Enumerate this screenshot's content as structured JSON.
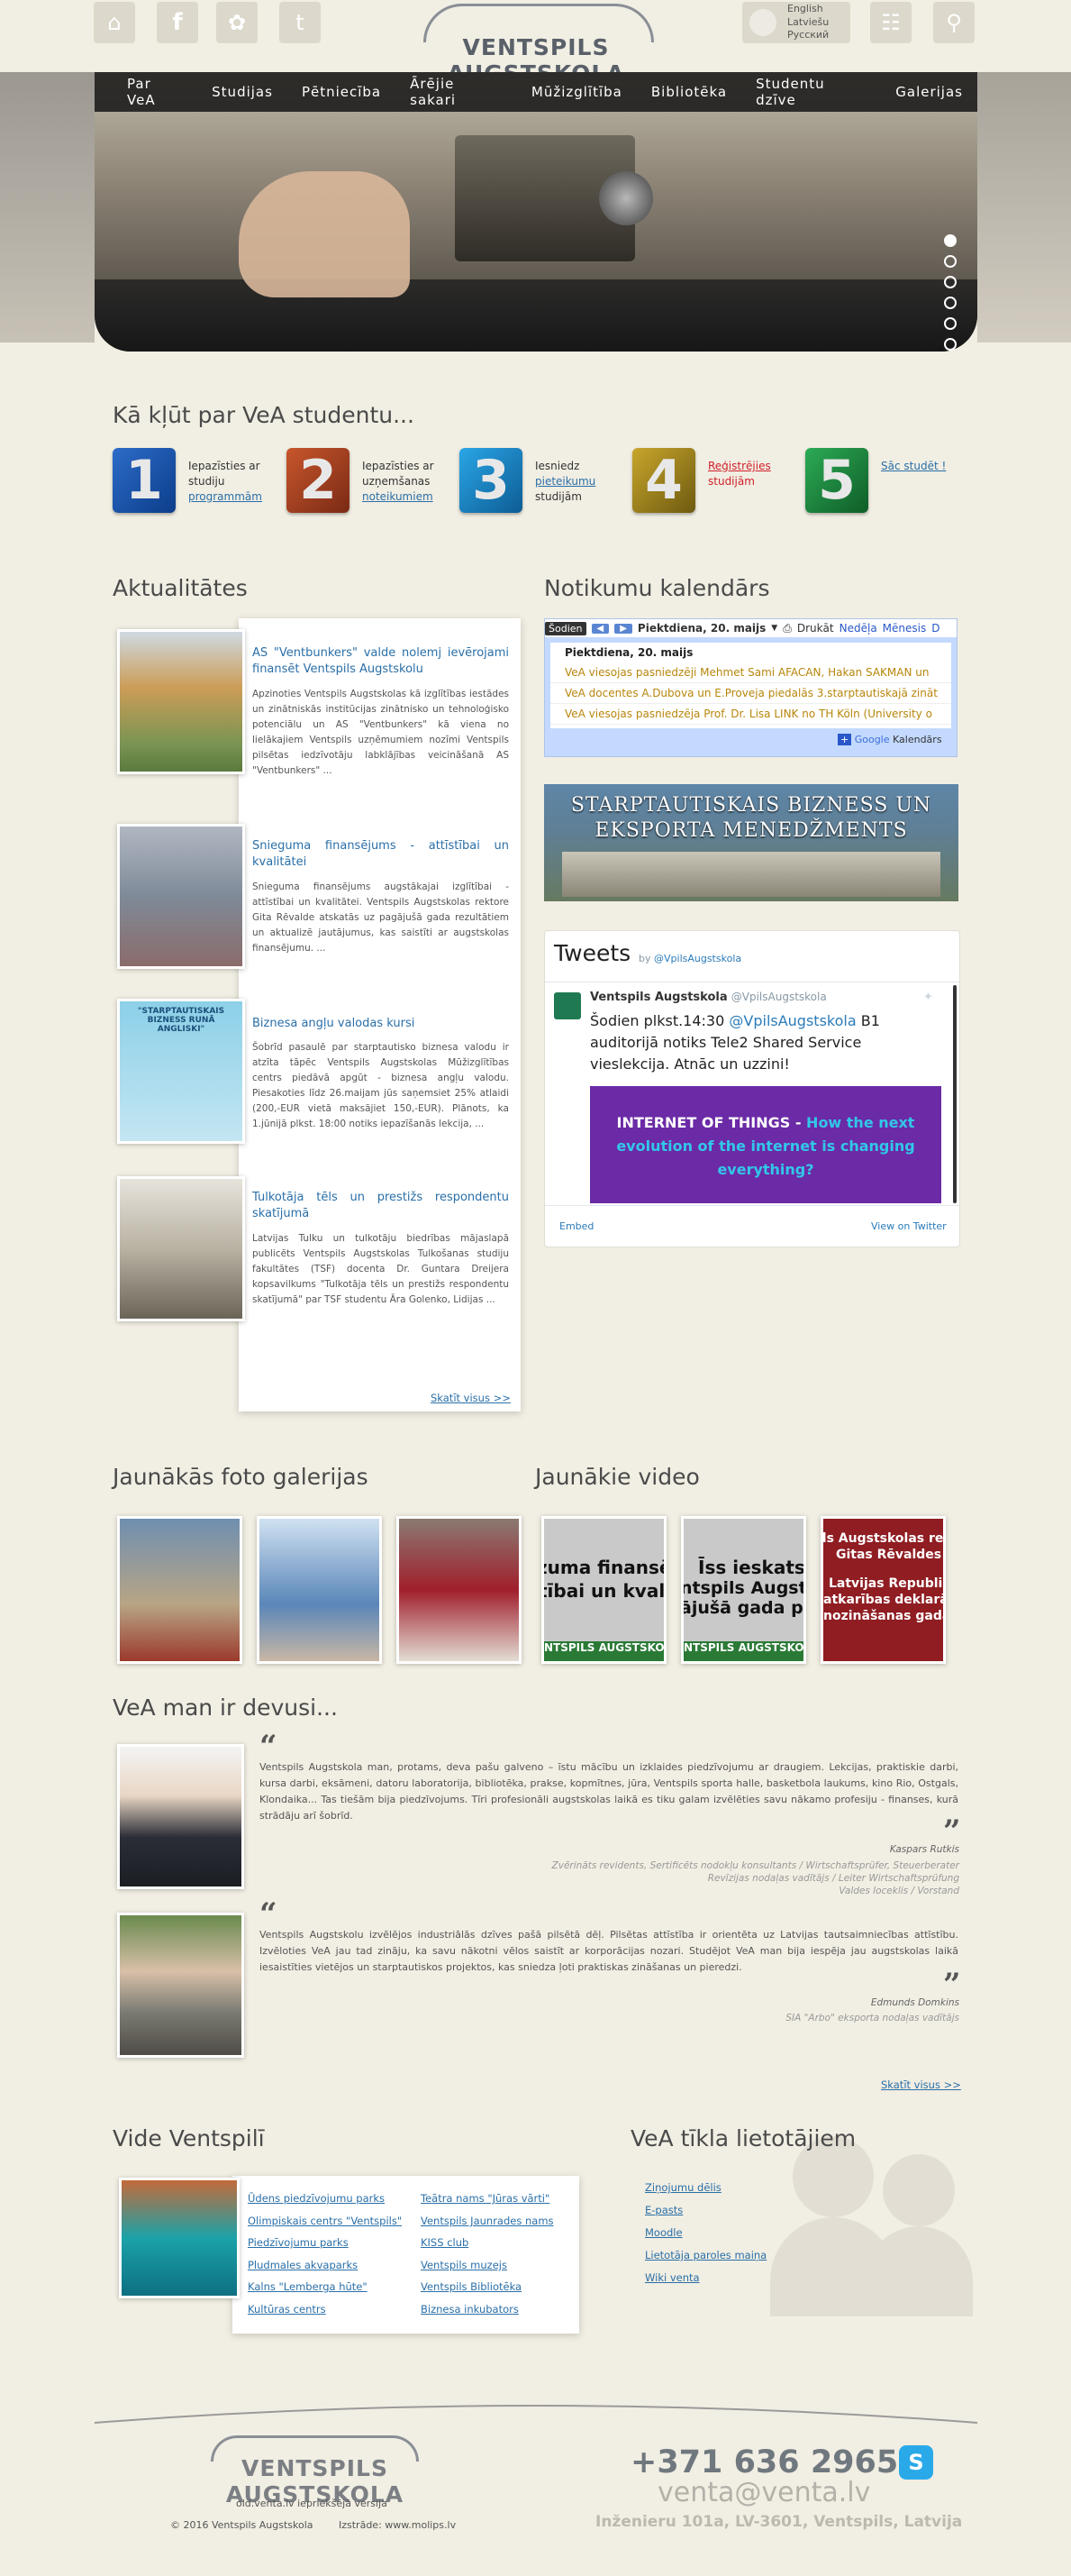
{
  "header": {
    "logo_text": "VENTSPILS AUGSTSKOLA",
    "languages": [
      "English",
      "Latviešu",
      "Русский"
    ]
  },
  "nav": [
    "Par VeA",
    "Studijas",
    "Pētniecība",
    "Ārējie sakari",
    "Mūžizglītība",
    "Bibliotēka",
    "Studentu dzīve",
    "Galerijas"
  ],
  "become_student": {
    "title": "Kā kļūt par VeA studentu...",
    "steps": [
      {
        "num": "1",
        "pre": "Iepazīsties ar studiju",
        "link": "programmām",
        "post": ""
      },
      {
        "num": "2",
        "pre": "Iepazīsties ar uzņemšanas",
        "link": "noteikumiem",
        "post": ""
      },
      {
        "num": "3",
        "pre": "Iesniedz",
        "link": "pieteikumu",
        "post": "studijām"
      },
      {
        "num": "4",
        "pre": "",
        "link": "Reģistrējies",
        "post": "studijām"
      },
      {
        "num": "5",
        "pre": "",
        "link": "Sāc studēt !",
        "post": ""
      }
    ]
  },
  "news": {
    "title": "Aktualitātes",
    "items": [
      {
        "title": "AS \"Ventbunkers\" valde nolemj ievērojami finansēt Ventspils Augstskolu",
        "text": "Apzinoties Ventspils Augstskolas kā izglītības iestādes un zinātniskās institūcijas zinātnisko un tehnoloģisko potenciālu un AS \"Ventbunkers\" kā viena no lielākajiem Ventspils uzņēmumiem nozīmi Ventspils pilsētas iedzīvotāju labklājības veicināšanā AS \"Ventbunkers\" ..."
      },
      {
        "title": "Snieguma finansējums - attīstībai un kvalitātei",
        "text": "Snieguma finansējums augstākajai izglītībai - attīstībai un kvalitātei. Ventspils Augstskolas rektore Gita Rēvalde atskatās uz pagājušā gada rezultātiem un aktualizē jautājumus, kas saistīti ar augstskolas finansējumu. ..."
      },
      {
        "title": "Biznesa angļu valodas kursi",
        "text": "Šobrīd pasaulē par starptautisko biznesa valodu ir atzīta tāpēc Ventspils Augstskolas Mūžizglītības centrs piedāvā apgūt - biznesa angļu valodu. Piesakoties līdz 26.maijam jūs saņemsiet 25% atlaidi (200,-EUR vietā maksājiet 150,-EUR). Plānots, ka 1.jūnijā plkst. 18:00 notiks iepazīšanās lekcija, ..."
      },
      {
        "title": "Tulkotāja tēls un prestižs respondentu skatījumā",
        "text": "Latvijas Tulku un tulkotāju biedrības mājaslapā publicēts Ventspils Augstskolas Tulkošanas studiju fakultātes (TSF) docenta Dr. Guntara Dreijera kopsavilkums \"Tulkotāja tēls un prestižs respondentu skatījumā\" par TSF studentu Āra Golenko, Lidijas ..."
      }
    ],
    "view_all": "Skatīt visus >>",
    "thumb_text": "\"STARPTAUTISKAIS BIZNESS RUNĀ ANGLISKI\""
  },
  "calendar": {
    "title": "Notikumu kalendārs",
    "today_btn": "Šodien",
    "date": "Piektdiena, 20. maijs",
    "print": "Drukāt",
    "week": "Nedēļa",
    "month": "Mēnesis",
    "agenda": "D",
    "day_header": "Piektdiena, 20. maijs",
    "events": [
      "VeA viesojas pasniedzēji Mehmet Sami AFACAN, Hakan SAKMAN un",
      "VeA docentes A.Dubova un E.Proveja piedalās 3.starptautiskajā zināt",
      "VeA viesojas pasniedzēja Prof. Dr. Lisa LINK no TH Köln (University o"
    ],
    "google_label": "Kalendārs",
    "google_brand": "Google"
  },
  "banner": {
    "text": "STARPTAUTISKAIS BIZNESS UN EKSPORTA MENEDŽMENTS"
  },
  "twitter": {
    "title": "Tweets",
    "by": "by",
    "handle_by": "@VpilsAugstskola",
    "user": "Ventspils Augstskola",
    "handle": "@VpilsAugstskola",
    "tweet_pre": "Šodien plkst.14:30",
    "tweet_mention": "@VpilsAugstskola",
    "tweet_post": "B1 auditorijā notiks Tele2 Shared Service vieslekcija. Atnāc un uzzini!",
    "card_white": "INTERNET OF THINGS -",
    "card_blue": "How the next evolution of the internet is changing everything?",
    "embed": "Embed",
    "view": "View on Twitter"
  },
  "photo_galleries": {
    "title": "Jaunākās foto galerijas"
  },
  "videos": {
    "title": "Jaunākie video",
    "thumbs": [
      {
        "top": "zuma finansēj",
        "mid": "tībai un kvalit",
        "bottom": "NTSPILS AUGSTSKO"
      },
      {
        "top": "Īss ieskats",
        "mid": "ntspils Augstsko",
        "bottom": "NTSPILS AUGSTSKO",
        "line3": "ājušā gada pārs"
      },
      {
        "top": "ils Augstskolas rek",
        "mid": "Gitas Rēvaldes",
        "line3": "Latvijas Republika",
        "line4": "atkarības deklarāc",
        "bottom": "nozināšanas gadadien"
      }
    ]
  },
  "testimonials": {
    "title": "VeA man ir devusi...",
    "items": [
      {
        "text": "Ventspils Augstskola man, protams, deva pašu galveno – īstu mācību un izklaides piedzīvojumu ar draugiem. Lekcijas, praktiskie darbi, kursa darbi, eksāmeni, datoru laboratorija, bibliotēka, prakse, kopmītnes, jūra, Ventspils sporta halle, basketbola laukums, kino Rio, Ostgals, Klondaika... Tas tiešām bija piedzīvojums. Tīri profesionāli augstskolas laikā es tiku galam izvēlēties savu nākamo profesiju - finanses, kurā strādāju arī šobrīd.",
        "name": "Kaspars Rutkis",
        "desc1": "Zvērināts revidents, Sertificēts nodokļu konsultants / Wirtschaftsprüfer, Steuerberater",
        "desc2": "Revīzijas nodaļas vadītājs / Leiter Wirtschaftsprüfung",
        "desc3": "Valdes loceklis / Vorstand"
      },
      {
        "text": "Ventspils Augstskolu izvēlējos industriālās dzīves pašā pilsētā dēļ. Pilsētas attīstība ir orientēta uz Latvijas tautsaimniecības attīstību. Izvēloties VeA jau tad zināju, ka savu nākotni vēlos saistīt ar korporācijas nozari. Studējot VeA man bija iespēja jau augstskolas laikā iesaistīties vietējos un starptautiskos projektos, kas sniedza ļoti praktiskas zināšanas un pieredzi.",
        "name": "Edmunds Domkins",
        "desc1": "SIA \"Arbo\" eksporta nodaļas vadītājs"
      }
    ],
    "view_all": "Skatīt visus >>"
  },
  "vide": {
    "title": "Vide Ventspilī",
    "col1": [
      "Ūdens piedzīvojumu parks",
      "Olimpiskais centrs \"Ventspils\"",
      "Piedzīvojumu parks",
      "Pludmales akvaparks",
      "Kalns \"Lemberga hūte\"",
      "Kultūras centrs"
    ],
    "col2": [
      "Teātra nams \"Jūras vārti\"",
      "Ventspils Jaunrades nams",
      "KISS club",
      "Ventspils muzejs",
      "Ventspils Bibliotēka",
      "Biznesa inkubators"
    ]
  },
  "network": {
    "title": "VeA tīkla lietotājiem",
    "links": [
      "Ziņojumu dēlis",
      "E-pasts",
      "Moodle",
      "Lietotāja paroles maiņa",
      "Wiki venta"
    ]
  },
  "footer": {
    "logo_text": "VENTSPILS AUGSTSKOLA",
    "old_site": "old.venta.lv iepriekšējā versija",
    "copyright": "© 2016 Ventspils Augstskola",
    "made_by": "Izstrāde: www.molips.lv",
    "phone": "+371 636 29657",
    "email": "venta@venta.lv",
    "address": "Inženieru 101a, LV-3601, Ventspils, Latvija"
  }
}
